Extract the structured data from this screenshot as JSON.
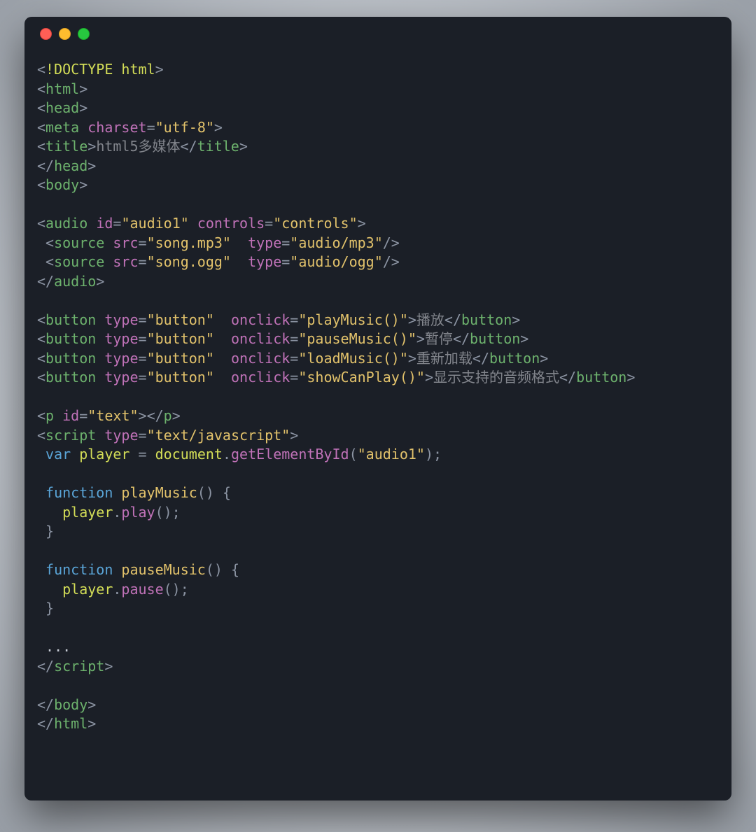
{
  "doctype": "!DOCTYPE html",
  "tags": {
    "html": "html",
    "head": "head",
    "meta": "meta",
    "title": "title",
    "body": "body",
    "audio": "audio",
    "source": "source",
    "button": "button",
    "p": "p",
    "script": "script"
  },
  "attrs": {
    "charset": "charset",
    "id": "id",
    "controls": "controls",
    "src": "src",
    "type": "type",
    "onclick": "onclick"
  },
  "vals": {
    "utf8": "\"utf-8\"",
    "audio1": "\"audio1\"",
    "controls": "\"controls\"",
    "song_mp3": "\"song.mp3\"",
    "type_mp3": "\"audio/mp3\"",
    "song_ogg": "\"song.ogg\"",
    "type_ogg": "\"audio/ogg\"",
    "btn_type": "\"button\"",
    "on_play": "\"playMusic()\"",
    "on_pause": "\"pauseMusic()\"",
    "on_load": "\"loadMusic()\"",
    "on_show": "\"showCanPlay()\"",
    "text_id": "\"text\"",
    "js_type": "\"text/javascript\"",
    "audio1_js": "\"audio1\""
  },
  "title_text": "html5多媒体",
  "labels": {
    "play": "播放",
    "pause": "暂停",
    "load": "重新加载",
    "show": "显示支持的音频格式"
  },
  "js": {
    "var": "var",
    "function": "function",
    "player": "player",
    "document": "document",
    "getElementById": "getElementById",
    "playMusic": "playMusic",
    "pauseMusic": "pauseMusic",
    "play": "play",
    "pause": "pause",
    "ellipsis": "..."
  }
}
